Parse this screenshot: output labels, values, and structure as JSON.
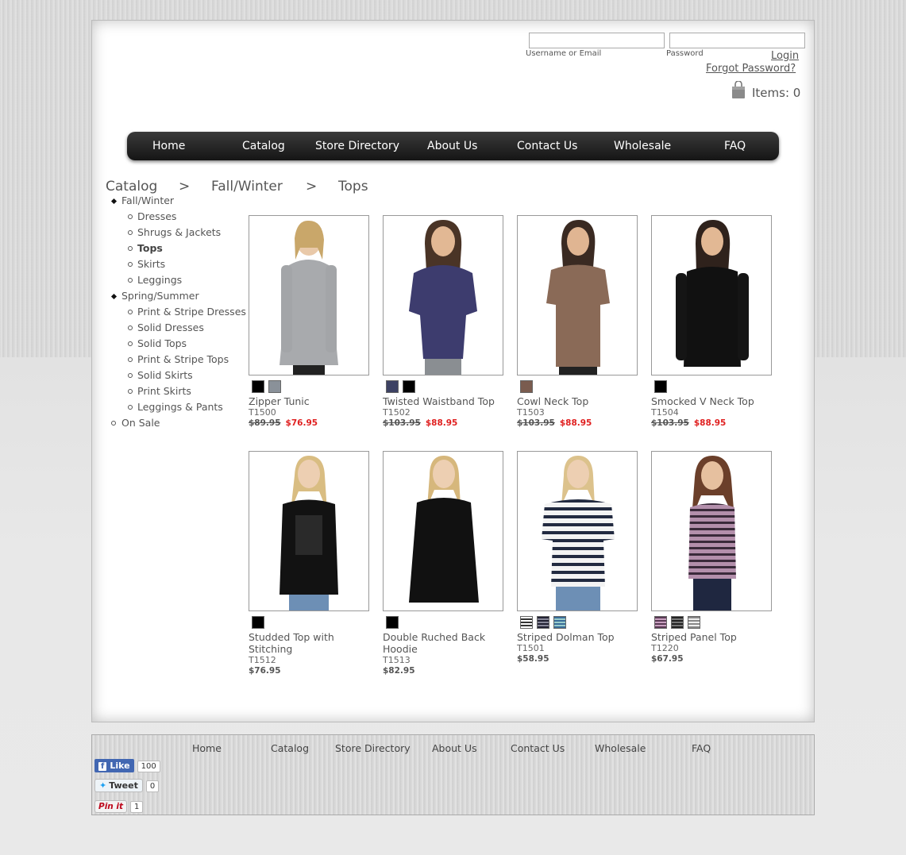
{
  "header": {
    "login": {
      "username_label": "Username or Email",
      "password_label": "Password",
      "login_link": "Login",
      "forgot_link": "Forgot Password?"
    },
    "cart": {
      "items_text": "Items: 0",
      "icon": "shopping-bag-icon"
    }
  },
  "nav": {
    "items": [
      "Home",
      "Catalog",
      "Store Directory",
      "About Us",
      "Contact Us",
      "Wholesale",
      "FAQ"
    ]
  },
  "breadcrumb": {
    "items": [
      "Catalog",
      "Fall/Winter",
      "Tops"
    ],
    "separator": ">"
  },
  "sidebar": {
    "fall_winter": {
      "label": "Fall/Winter",
      "children": [
        "Dresses",
        "Shrugs & Jackets",
        "Tops",
        "Skirts",
        "Leggings"
      ]
    },
    "spring_summer": {
      "label": "Spring/Summer",
      "children": [
        "Print & Stripe Dresses",
        "Solid Dresses",
        "Solid Tops",
        "Print & Stripe Tops",
        "Solid Skirts",
        "Print Skirts",
        "Leggings & Pants"
      ]
    },
    "on_sale": {
      "label": "On Sale"
    }
  },
  "products": [
    {
      "name": "Zipper Tunic",
      "code": "T1500",
      "old_price": "$89.95",
      "price": "$76.95",
      "swatches": [
        "#000000",
        "#8a9199"
      ]
    },
    {
      "name": "Twisted Waistband Top",
      "code": "T1502",
      "old_price": "$103.95",
      "price": "$88.95",
      "swatches": [
        "#3d4263",
        "#000000"
      ]
    },
    {
      "name": "Cowl Neck Top",
      "code": "T1503",
      "old_price": "$103.95",
      "price": "$88.95",
      "swatches": [
        "#7a5c4f"
      ]
    },
    {
      "name": "Smocked V Neck Top",
      "code": "T1504",
      "old_price": "$103.95",
      "price": "$88.95",
      "swatches": [
        "#000000"
      ]
    },
    {
      "name": "Studded Top with Stitching",
      "code": "T1512",
      "price": "$76.95",
      "swatches": [
        "#000000"
      ]
    },
    {
      "name": "Double Ruched Back Hoodie",
      "code": "T1513",
      "price": "$82.95",
      "swatches": [
        "#000000"
      ]
    },
    {
      "name": "Striped Dolman Top",
      "code": "T1501",
      "price": "$58.95",
      "swatches": [
        "stripe-white",
        "stripe-navy",
        "stripe-blue"
      ]
    },
    {
      "name": "Striped Panel Top",
      "code": "T1220",
      "price": "$67.95",
      "swatches": [
        "stripe-plum",
        "stripe-charcoal",
        "stripe-grey"
      ]
    }
  ],
  "colors": {
    "sale_price": "#e02020",
    "nav_bar": "#1e1e1e",
    "facebook": "#4267b2",
    "pinterest": "#bd081c"
  },
  "footer": {
    "links": [
      "Home",
      "Catalog",
      "Store Directory",
      "About Us",
      "Contact Us",
      "Wholesale",
      "FAQ"
    ],
    "social": {
      "facebook_label": "Like",
      "facebook_count": "100",
      "twitter_label": "Tweet",
      "twitter_count": "0",
      "pinterest_label": "Pin it",
      "pinterest_count": "1"
    }
  }
}
